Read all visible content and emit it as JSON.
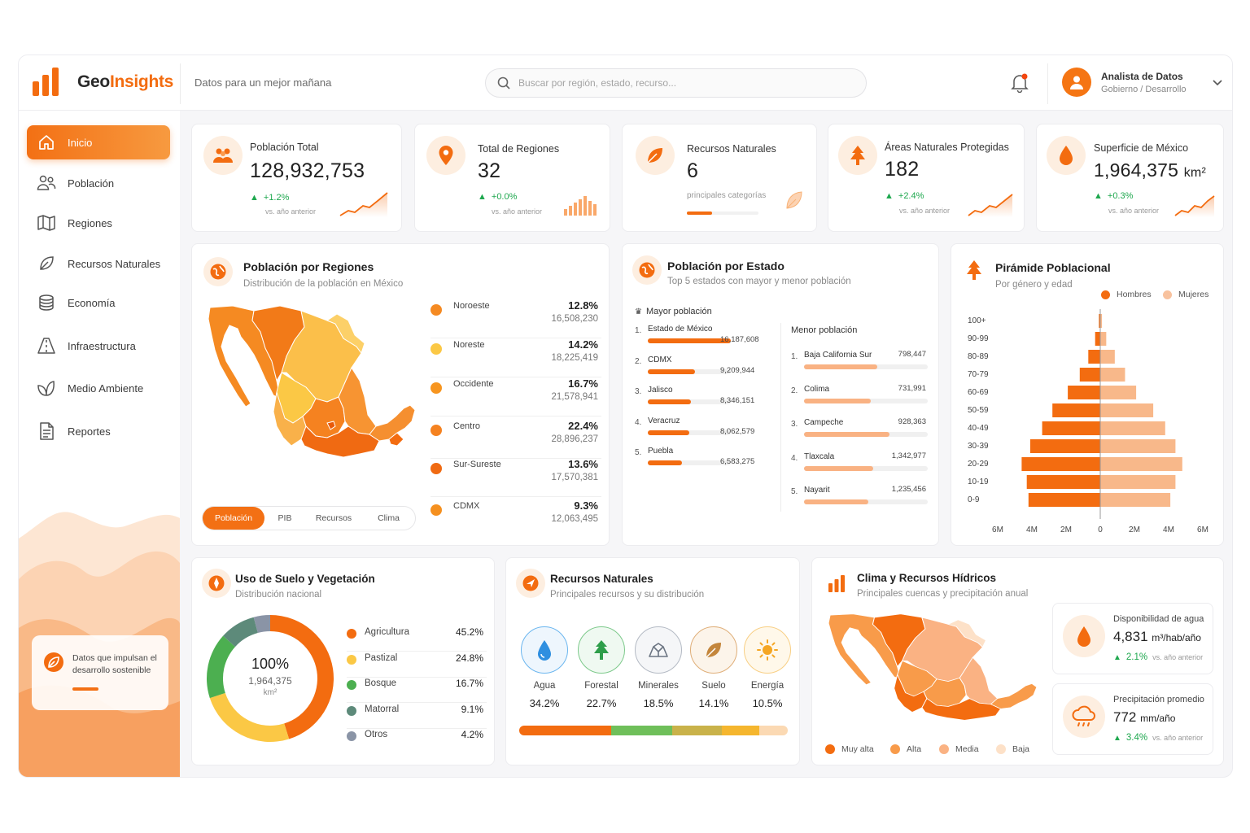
{
  "app": {
    "logo_a": "Geo",
    "logo_b": "Insights",
    "tagline": "Datos para un mejor mañana"
  },
  "search": {
    "placeholder": "Buscar por región, estado, recurso..."
  },
  "user": {
    "name": "Analista de Datos",
    "role": "Gobierno / Desarrollo"
  },
  "nav": [
    {
      "label": "Inicio",
      "icon": "home-icon",
      "active": true
    },
    {
      "label": "Población",
      "icon": "people-icon"
    },
    {
      "label": "Regiones",
      "icon": "map-icon"
    },
    {
      "label": "Recursos Naturales",
      "icon": "leaf-icon"
    },
    {
      "label": "Economía",
      "icon": "coins-icon"
    },
    {
      "label": "Infraestructura",
      "icon": "road-icon"
    },
    {
      "label": "Medio Ambiente",
      "icon": "plant-icon"
    },
    {
      "label": "Reportes",
      "icon": "document-icon"
    }
  ],
  "promo": {
    "text": "Datos que impulsan el desarrollo sostenible"
  },
  "kpis": [
    {
      "label": "Población Total",
      "value": "128,932,753",
      "change": "+1.2%",
      "note": "vs. año anterior",
      "icon": "people-icon"
    },
    {
      "label": "Total de Regiones",
      "value": "32",
      "change": "+0.0%",
      "note": "vs. año anterior",
      "icon": "map-pin-icon"
    },
    {
      "label": "Recursos Naturales",
      "value": "6",
      "note": "principales categorías",
      "icon": "leaf-icon",
      "progress": 0.35
    },
    {
      "label": "Áreas Naturales Protegidas",
      "value": "182",
      "change": "+2.4%",
      "note": "vs. año anterior",
      "icon": "tree-icon"
    },
    {
      "label": "Superficie de México",
      "value": "1,964,375",
      "unit": "km²",
      "change": "+0.3%",
      "note": "vs. año anterior",
      "icon": "drop-icon"
    }
  ],
  "regiones": {
    "title": "Población por Regiones",
    "subtitle": "Distribución de la población en México",
    "rows": [
      {
        "name": "Noroeste",
        "pct": "12.8%",
        "value": "16,508,230",
        "color": "#f58a22"
      },
      {
        "name": "Noreste",
        "pct": "14.2%",
        "value": "18,225,419",
        "color": "#fbc845"
      },
      {
        "name": "Occidente",
        "pct": "16.7%",
        "value": "21,578,941",
        "color": "#f7951f"
      },
      {
        "name": "Centro",
        "pct": "22.4%",
        "value": "28,896,237",
        "color": "#f58220"
      },
      {
        "name": "Sur-Sureste",
        "pct": "13.6%",
        "value": "17,570,381",
        "color": "#f06a12"
      },
      {
        "name": "CDMX",
        "pct": "9.3%",
        "value": "12,063,495",
        "color": "#f5901f"
      }
    ],
    "tabs": [
      "Población",
      "PIB",
      "Recursos",
      "Clima"
    ]
  },
  "estados": {
    "title": "Población por Estado",
    "subtitle": "Top 5 estados con mayor y menor población",
    "mayor_label": "Mayor población",
    "menor_label": "Menor población",
    "mayor": [
      {
        "rank": "1.",
        "name": "Estado de México",
        "value": "16,187,608",
        "frac": 1.0
      },
      {
        "rank": "2.",
        "name": "CDMX",
        "value": "9,209,944",
        "frac": 0.57
      },
      {
        "rank": "3.",
        "name": "Jalisco",
        "value": "8,346,151",
        "frac": 0.52
      },
      {
        "rank": "4.",
        "name": "Veracruz",
        "value": "8,062,579",
        "frac": 0.5
      },
      {
        "rank": "5.",
        "name": "Puebla",
        "value": "6,583,275",
        "frac": 0.41
      }
    ],
    "menor": [
      {
        "rank": "1.",
        "name": "Baja California Sur",
        "value": "798,447",
        "frac": 0.59
      },
      {
        "rank": "2.",
        "name": "Colima",
        "value": "731,991",
        "frac": 0.54
      },
      {
        "rank": "3.",
        "name": "Campeche",
        "value": "928,363",
        "frac": 0.69
      },
      {
        "rank": "4.",
        "name": "Tlaxcala",
        "value": "1,342,977",
        "frac": 0.56
      },
      {
        "rank": "5.",
        "name": "Nayarit",
        "value": "1,235,456",
        "frac": 0.52
      }
    ]
  },
  "piramide": {
    "title": "Pirámide Poblacional",
    "subtitle": "Por género y edad",
    "legend": [
      {
        "name": "Hombres",
        "color": "#f36c10"
      },
      {
        "name": "Mujeres",
        "color": "#f8b88a"
      }
    ],
    "chart_data": {
      "type": "bar",
      "orientation": "horizontal-diverging",
      "categories": [
        "100+",
        "90-99",
        "80-89",
        "70-79",
        "60-69",
        "50-59",
        "40-49",
        "30-39",
        "20-29",
        "10-19",
        "0-9"
      ],
      "series": [
        {
          "name": "Hombres",
          "values": [
            0.08,
            0.3,
            0.7,
            1.2,
            1.9,
            2.8,
            3.4,
            4.1,
            4.6,
            4.3,
            4.2
          ]
        },
        {
          "name": "Mujeres",
          "values": [
            0.1,
            0.35,
            0.85,
            1.45,
            2.1,
            3.1,
            3.8,
            4.4,
            4.8,
            4.4,
            4.1
          ]
        }
      ],
      "xticks": [
        "6M",
        "4M",
        "2M",
        "0",
        "2M",
        "4M",
        "6M"
      ],
      "xlim": [
        -6,
        6
      ]
    }
  },
  "suelo": {
    "title": "Uso de Suelo y Vegetación",
    "subtitle": "Distribución nacional",
    "center_pct": "100%",
    "center_value": "1,964,375",
    "center_unit": "km²",
    "chart_data": {
      "type": "pie",
      "categories": [
        "Agricultura",
        "Pastizal",
        "Bosque",
        "Matorral",
        "Otros"
      ],
      "values": [
        45.2,
        24.8,
        16.7,
        9.1,
        4.2
      ],
      "colors": [
        "#f36c10",
        "#fbc845",
        "#4caf50",
        "#5d8a7a",
        "#8a94a6"
      ]
    },
    "rows": [
      {
        "name": "Agricultura",
        "pct": "45.2%",
        "color": "#f36c10"
      },
      {
        "name": "Pastizal",
        "pct": "24.8%",
        "color": "#fbc845"
      },
      {
        "name": "Bosque",
        "pct": "16.7%",
        "color": "#4caf50"
      },
      {
        "name": "Matorral",
        "pct": "9.1%",
        "color": "#5d8a7a"
      },
      {
        "name": "Otros",
        "pct": "4.2%",
        "color": "#8a94a6"
      }
    ]
  },
  "recursos": {
    "title": "Recursos Naturales",
    "subtitle": "Principales recursos y su distribución",
    "items": [
      {
        "name": "Agua",
        "pct": "34.2%",
        "icon": "water-drop-icon",
        "color": "#2f8fe0",
        "value": 34.2
      },
      {
        "name": "Forestal",
        "pct": "22.7%",
        "icon": "pine-tree-icon",
        "color": "#2e9e4a",
        "value": 22.7
      },
      {
        "name": "Minerales",
        "pct": "18.5%",
        "icon": "minerals-icon",
        "color": "#7d8796",
        "value": 18.5
      },
      {
        "name": "Suelo",
        "pct": "14.1%",
        "icon": "soil-leaf-icon",
        "color": "#c4863c",
        "value": 14.1
      },
      {
        "name": "Energía",
        "pct": "10.5%",
        "icon": "sun-icon",
        "color": "#f5a623",
        "value": 10.5
      }
    ],
    "bar_colors": [
      "#f36c10",
      "#6fbf5a",
      "#c9b24a",
      "#f5b62e",
      "#fbd9b3"
    ]
  },
  "clima": {
    "title": "Clima y Recursos Hídricos",
    "subtitle": "Principales cuencas y precipitación anual",
    "legend": [
      {
        "name": "Muy alta",
        "color": "#f36c10"
      },
      {
        "name": "Alta",
        "color": "#f89b4a"
      },
      {
        "name": "Media",
        "color": "#fab283"
      },
      {
        "name": "Baja",
        "color": "#fde1c8"
      }
    ],
    "agua": {
      "label": "Disponibilidad de agua",
      "value": "4,831",
      "unit": "m³/hab/año",
      "change": "2.1%",
      "note": "vs. año anterior"
    },
    "precip": {
      "label": "Precipitación promedio",
      "value": "772",
      "unit": "mm/año",
      "change": "3.4%",
      "note": "vs. año anterior"
    }
  }
}
